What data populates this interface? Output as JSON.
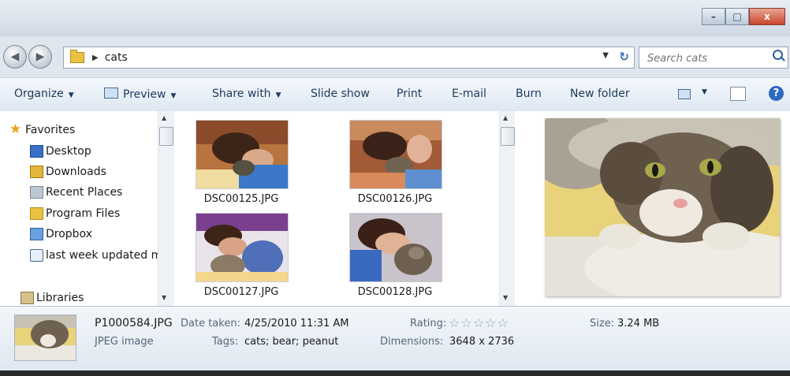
{
  "address": {
    "breadcrumb": "cats"
  },
  "search": {
    "placeholder": "Search cats"
  },
  "toolbar": {
    "organize": "Organize",
    "preview": "Preview",
    "share_with": "Share with",
    "slide_show": "Slide show",
    "print": "Print",
    "email": "E-mail",
    "burn": "Burn",
    "new_folder": "New folder",
    "help": "?"
  },
  "window_buttons": {
    "minimize": "–",
    "maximize": "□",
    "close": "x"
  },
  "nav": {
    "favorites": "Favorites",
    "items": [
      "Desktop",
      "Downloads",
      "Recent Places",
      "Program Files",
      "Dropbox",
      "last week updated m"
    ],
    "libraries": "Libraries"
  },
  "files": [
    {
      "name": "DSC00125.JPG"
    },
    {
      "name": "DSC00126.JPG"
    },
    {
      "name": "DSC00127.JPG"
    },
    {
      "name": "DSC00128.JPG"
    }
  ],
  "details": {
    "filename": "P1000584.JPG",
    "filetype": "JPEG image",
    "date_label": "Date taken:",
    "date_value": "4/25/2010 11:31 AM",
    "tags_label": "Tags:",
    "tags_value": "cats; bear; peanut",
    "rating_label": "Rating:",
    "rating_stars": 0,
    "dimensions_label": "Dimensions:",
    "dimensions_value": "3648 x 2736",
    "size_label": "Size:",
    "size_value": "3.24 MB"
  }
}
